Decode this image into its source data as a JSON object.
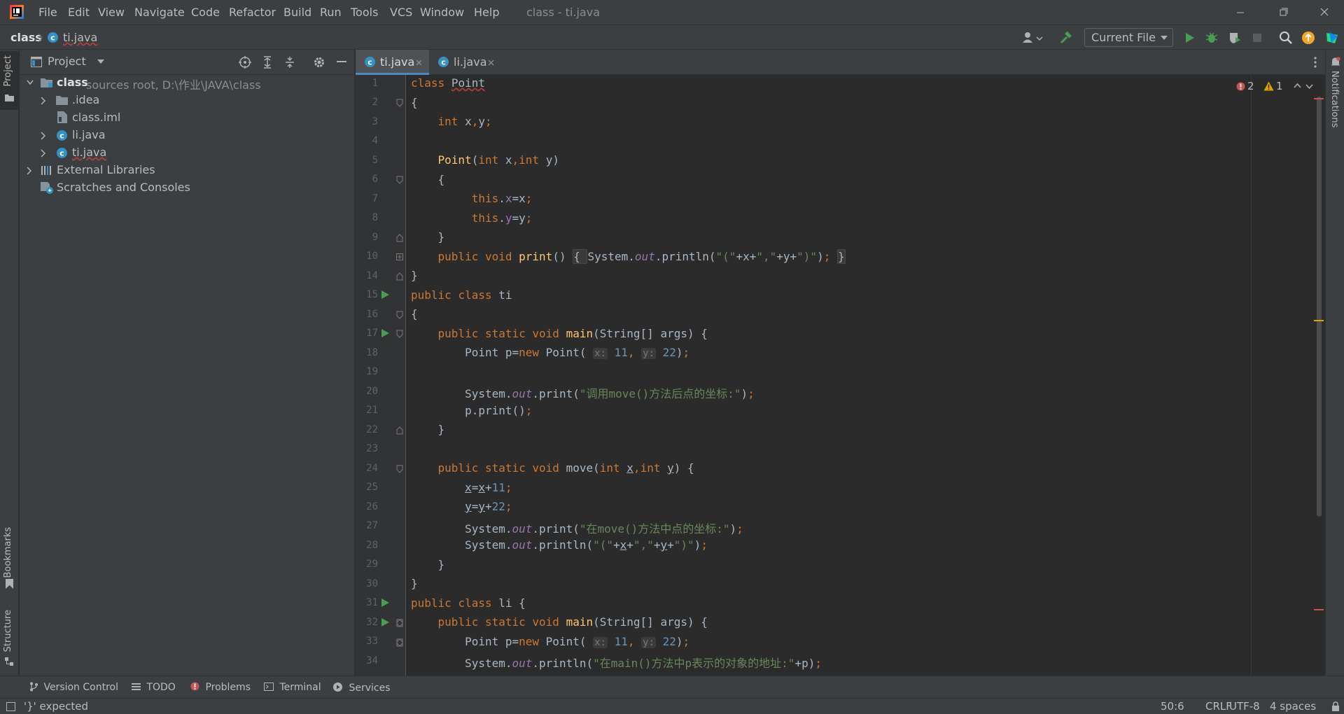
{
  "app": {
    "window_title": "class - ti.java",
    "menu": [
      "File",
      "Edit",
      "View",
      "Navigate",
      "Code",
      "Refactor",
      "Build",
      "Run",
      "Tools",
      "VCS",
      "Window",
      "Help"
    ]
  },
  "navbar": {
    "breadcrumb_project": "class",
    "breadcrumb_file": "ti.java",
    "run_config": "Current File"
  },
  "left_stripe": {
    "project": "Project",
    "bookmarks": "Bookmarks",
    "structure": "Structure"
  },
  "right_stripe": {
    "notifications": "Notifications"
  },
  "project_panel": {
    "title": "Project",
    "tree": [
      {
        "label": "class",
        "suffix": "sources root,  D:\\作业\\JAVA\\class",
        "kind": "module",
        "expanded": true
      },
      {
        "label": ".idea",
        "kind": "folder",
        "expanded": false
      },
      {
        "label": "class.iml",
        "kind": "iml"
      },
      {
        "label": "li.java",
        "kind": "java",
        "expanded": false
      },
      {
        "label": "ti.java",
        "kind": "java",
        "expanded": false
      },
      {
        "label": "External Libraries",
        "kind": "libraries",
        "expanded": false
      },
      {
        "label": "Scratches and Consoles",
        "kind": "scratches"
      }
    ]
  },
  "editor": {
    "tabs": [
      {
        "label": "ti.java",
        "active": true
      },
      {
        "label": "li.java",
        "active": false
      }
    ],
    "inspections": {
      "errors": "2",
      "warnings": "1"
    },
    "lines": [
      {
        "n": "1",
        "text": "class Point"
      },
      {
        "n": "2",
        "text": "{"
      },
      {
        "n": "3",
        "text": "    int x,y;"
      },
      {
        "n": "4",
        "text": ""
      },
      {
        "n": "5",
        "text": "    Point(int x,int y)"
      },
      {
        "n": "6",
        "text": "    {"
      },
      {
        "n": "7",
        "text": "         this.x=x;"
      },
      {
        "n": "8",
        "text": "         this.y=y;"
      },
      {
        "n": "9",
        "text": "    }"
      },
      {
        "n": "10",
        "text": "    public void print() { System.out.println(\"(\"+x+\",\"+y+\")\"); }"
      },
      {
        "n": "14",
        "text": "}"
      },
      {
        "n": "15",
        "text": "public class ti"
      },
      {
        "n": "16",
        "text": "{"
      },
      {
        "n": "17",
        "text": "    public static void main(String[] args) {"
      },
      {
        "n": "18",
        "text": "        Point p=new Point( x: 11, y: 22);"
      },
      {
        "n": "19",
        "text": ""
      },
      {
        "n": "20",
        "text": "        System.out.print(\"调用move()方法后点的坐标:\");"
      },
      {
        "n": "21",
        "text": "        p.print();"
      },
      {
        "n": "22",
        "text": "    }"
      },
      {
        "n": "23",
        "text": ""
      },
      {
        "n": "24",
        "text": "    public static void move(int x,int y) {"
      },
      {
        "n": "25",
        "text": "        x=x+11;"
      },
      {
        "n": "26",
        "text": "        y=y+22;"
      },
      {
        "n": "27",
        "text": "        System.out.print(\"在move()方法中点的坐标:\");"
      },
      {
        "n": "28",
        "text": "        System.out.println(\"(\"+x+\",\"+y+\")\");"
      },
      {
        "n": "29",
        "text": "    }"
      },
      {
        "n": "30",
        "text": "}"
      },
      {
        "n": "31",
        "text": "public class li {"
      },
      {
        "n": "32",
        "text": "    public static void main(String[] args) {"
      },
      {
        "n": "33",
        "text": "        Point p=new Point( x: 11, y: 22);"
      },
      {
        "n": "34",
        "text": "        System.out.println(\"在main()方法中p表示的对象的地址:\"+p);"
      }
    ]
  },
  "tool_windows": [
    "Version Control",
    "TODO",
    "Problems",
    "Terminal",
    "Services"
  ],
  "status": {
    "message": "'}' expected",
    "position": "50:6",
    "line_sep": "CRLF",
    "encoding": "UTF-8",
    "indent": "4 spaces"
  },
  "colors": {
    "keyword": "#cc7832",
    "function": "#ffc66d",
    "field": "#9876aa",
    "string": "#6a8759",
    "number": "#6897bb",
    "run_green": "#499c54",
    "error_red": "#c75450",
    "warning_yellow": "#e2a300",
    "update_orange": "#f4a529"
  }
}
